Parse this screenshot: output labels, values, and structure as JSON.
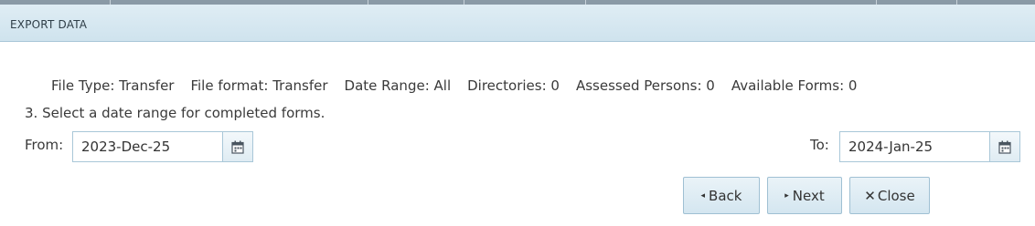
{
  "dialog": {
    "title": "EXPORT DATA"
  },
  "summary": {
    "file_type": "File Type: Transfer",
    "file_format": "File format: Transfer",
    "date_range": "Date Range: All",
    "directories": "Directories: 0",
    "assessed_persons": "Assessed Persons: 0",
    "available_forms": "Available Forms: 0"
  },
  "instruction": "3. Select a date range for completed forms.",
  "from": {
    "label": "From:",
    "value": "2023-Dec-25"
  },
  "to": {
    "label": "To:",
    "value": "2024-Jan-25"
  },
  "buttons": {
    "back": {
      "icon": "◂",
      "label": "Back"
    },
    "next": {
      "icon": "▸",
      "label": "Next"
    },
    "close": {
      "icon": "✕",
      "label": "Close"
    }
  },
  "icons": {
    "calendar": "calendar-icon"
  },
  "colors": {
    "titlebar": "#d6e8f1",
    "border": "#a9c7d8",
    "button": "#deedf4"
  }
}
